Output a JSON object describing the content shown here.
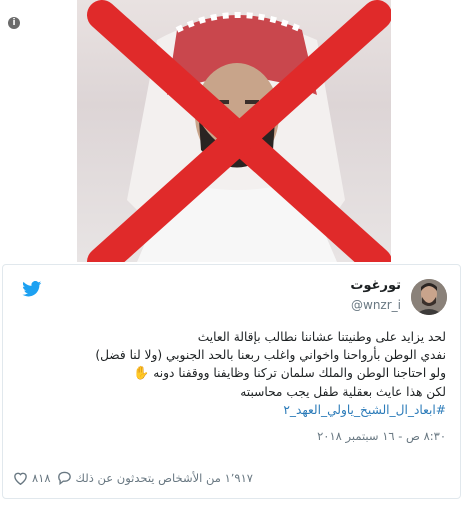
{
  "header": {
    "info_icon": "info-icon"
  },
  "tweet": {
    "display_name": "تورغوت",
    "handle": "@wnzr_i",
    "lines": [
      "لحد يزايد على وطنيتنا عشاننا نطالب بإقالة العايث",
      "نفدي الوطن بأرواحنا واخواني واغلب ربعنا بالحد الجنوبي (ولا لنا فضل)",
      "ولو احتاجنا الوطن والملك سلمان تركنا وظايفنا ووقفنا دونه",
      "لكن هذا عايث بعقلية طفل يجب محاسبته"
    ],
    "hashtag": "#ابعاد_ال_الشيخ_ياولي_العهد_٢",
    "hand_emoji": "✋",
    "timestamp": "٨:٣٠ ص - ١٦ سبتمبر ٢٠١٨",
    "likes": "٨١٨",
    "replies_text": "١٬٩١٧ من الأشخاص يتحدثون عن ذلك"
  },
  "colors": {
    "twitter_blue": "#1da1f2",
    "link": "#2b7bb9",
    "cross_red": "#e02a2a"
  }
}
